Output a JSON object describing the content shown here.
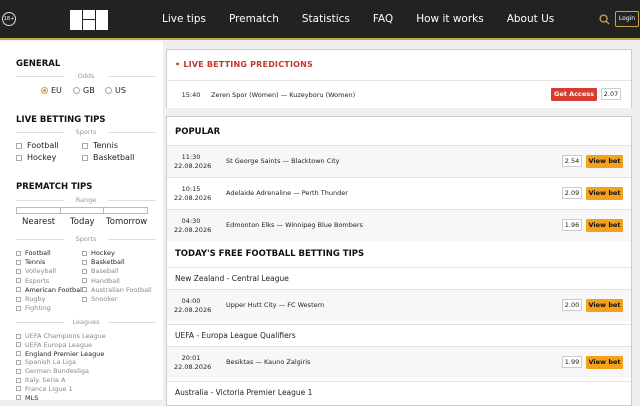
{
  "header": {
    "age_badge": "18+",
    "nav": [
      "Live tips",
      "Prematch",
      "Statistics",
      "FAQ",
      "How it works",
      "About Us"
    ],
    "login_label": "Login",
    "colors": {
      "bg": "#222222",
      "accent": "#c9a24a"
    }
  },
  "sidebar": {
    "general_title": "GENERAL",
    "odds_label": "Odds",
    "odds_options": [
      "EU",
      "GB",
      "US"
    ],
    "odds_selected": "EU",
    "live_title": "LIVE BETTING TIPS",
    "live_sports_label": "Sports",
    "live_sports": [
      "Football",
      "Tennis",
      "Hockey",
      "Basketball"
    ],
    "prematch_title": "PREMATCH TIPS",
    "range_label": "Range",
    "range_options": [
      "Nearest",
      "Today",
      "Tomorrow"
    ],
    "sports_label": "Sports",
    "sports": [
      {
        "label": "Football",
        "dim": false
      },
      {
        "label": "Hockey",
        "dim": false
      },
      {
        "label": "Tennis",
        "dim": false
      },
      {
        "label": "Basketball",
        "dim": false
      },
      {
        "label": "Volleyball",
        "dim": true
      },
      {
        "label": "Baseball",
        "dim": true
      },
      {
        "label": "Esports",
        "dim": true
      },
      {
        "label": "Handball",
        "dim": true
      },
      {
        "label": "American Football",
        "dim": false
      },
      {
        "label": "Australian Football",
        "dim": true
      },
      {
        "label": "Rugby",
        "dim": true
      },
      {
        "label": "Snooker",
        "dim": true
      },
      {
        "label": "Fighting",
        "dim": true
      }
    ],
    "leagues_label": "Leagues",
    "leagues": [
      {
        "label": "UEFA Champions League",
        "dim": true
      },
      {
        "label": "UEFA Europa League",
        "dim": true
      },
      {
        "label": "England Premier League",
        "dim": false
      },
      {
        "label": "Spanish La Liga",
        "dim": true
      },
      {
        "label": "German Bundesliga",
        "dim": true
      },
      {
        "label": "Italy. Seria A",
        "dim": true
      },
      {
        "label": "France Ligue 1",
        "dim": true
      },
      {
        "label": "MLS",
        "dim": false
      }
    ]
  },
  "live": {
    "title": "LIVE BETTING PREDICTIONS",
    "row": {
      "time": "15:40",
      "match": "Zeren Spor (Women) — Kuzeyboru (Women)",
      "button": "Get Access",
      "odds": "2.07"
    }
  },
  "popular": {
    "title": "POPULAR",
    "rows": [
      {
        "time": "11:30",
        "date": "22.08.2026",
        "match": "St George Saints — Blacktown City",
        "odds": "2.54",
        "button": "View bet"
      },
      {
        "time": "10:15",
        "date": "22.08.2026",
        "match": "Adelaide Adrenaline — Perth Thunder",
        "odds": "2.09",
        "button": "View bet"
      },
      {
        "time": "04:30",
        "date": "22.08.2026",
        "match": "Edmonton Elks — Winnipeg Blue Bombers",
        "odds": "1.96",
        "button": "View bet"
      }
    ]
  },
  "free": {
    "title": "TODAY'S FREE FOOTBALL BETTING TIPS",
    "leagues": [
      "New Zealand - Central League",
      "UEFA - Europa League Qualifiers",
      "Australia - Victoria Premier League 1"
    ],
    "rows": [
      {
        "time": "04:00",
        "date": "22.08.2026",
        "match": "Upper Hutt City — FC Western",
        "odds": "2.00",
        "button": "View bet"
      },
      {
        "time": "20:01",
        "date": "22.08.2026",
        "match": "Besiktas — Kauno Zalgiris",
        "odds": "1.99",
        "button": "View bet"
      }
    ]
  }
}
